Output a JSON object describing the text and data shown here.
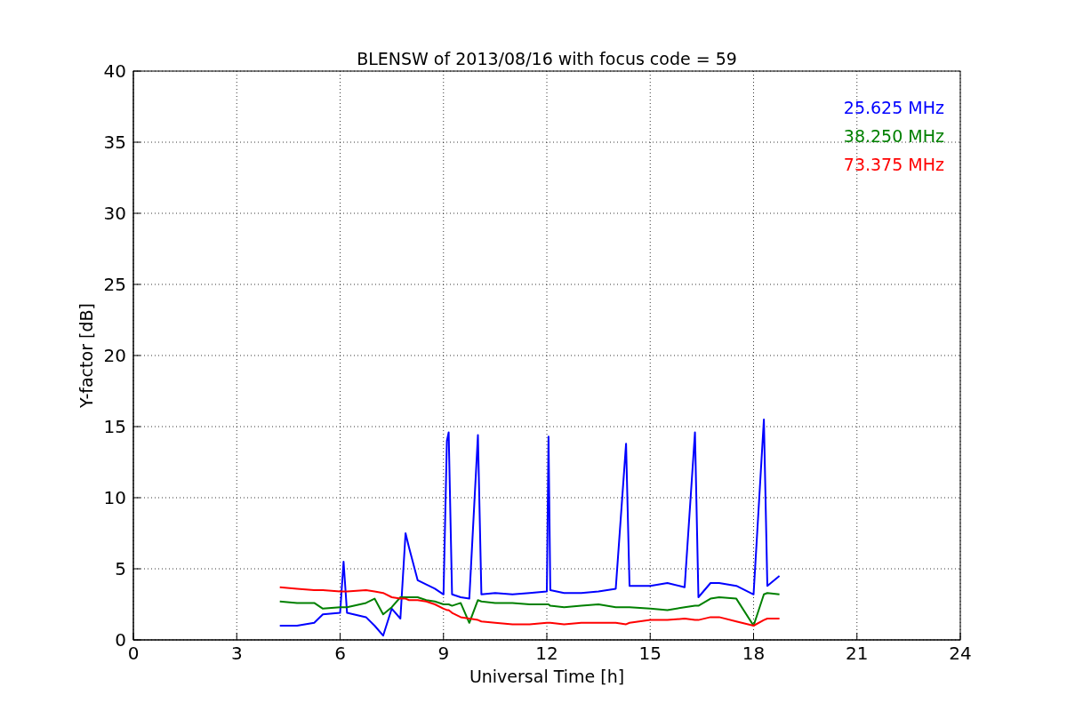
{
  "figure": {
    "chart_data": {
      "type": "line",
      "title": "BLENSW of 2013/08/16 with focus code = 59",
      "xlabel": "Universal Time [h]",
      "ylabel": "Y-factor [dB]",
      "x": [
        4.25,
        4.75,
        5.25,
        5.5,
        6.0,
        6.1,
        6.2,
        6.75,
        7.0,
        7.25,
        7.5,
        7.75,
        7.9,
        8.0,
        8.25,
        8.5,
        8.75,
        9.0,
        9.1,
        9.15,
        9.25,
        9.5,
        9.75,
        10.0,
        10.1,
        10.5,
        11.0,
        11.5,
        12.0,
        12.05,
        12.1,
        12.5,
        13.0,
        13.5,
        14.0,
        14.3,
        14.4,
        15.0,
        15.5,
        16.0,
        16.3,
        16.4,
        16.75,
        17.0,
        17.5,
        18.0,
        18.3,
        18.4,
        18.75
      ],
      "series": [
        {
          "name": "25.625 MHz",
          "color": "#0000ff",
          "values": [
            1.0,
            1.0,
            1.2,
            1.8,
            1.9,
            5.5,
            1.9,
            1.6,
            1.0,
            0.3,
            2.2,
            1.5,
            7.5,
            6.5,
            4.2,
            3.9,
            3.6,
            3.2,
            14.0,
            14.6,
            3.2,
            3.0,
            2.9,
            14.4,
            3.2,
            3.3,
            3.2,
            3.3,
            3.4,
            14.3,
            3.5,
            3.3,
            3.3,
            3.4,
            3.6,
            13.8,
            3.8,
            3.8,
            4.0,
            3.7,
            14.6,
            3.0,
            4.0,
            4.0,
            3.8,
            3.2,
            15.5,
            3.8,
            4.5
          ]
        },
        {
          "name": "38.250 MHz",
          "color": "#008000",
          "values": [
            2.7,
            2.6,
            2.6,
            2.2,
            2.3,
            2.3,
            2.3,
            2.6,
            2.9,
            1.8,
            2.3,
            3.0,
            3.0,
            3.0,
            3.0,
            2.8,
            2.7,
            2.5,
            2.5,
            2.5,
            2.4,
            2.6,
            1.2,
            2.8,
            2.7,
            2.6,
            2.6,
            2.5,
            2.5,
            2.5,
            2.4,
            2.3,
            2.4,
            2.5,
            2.3,
            2.3,
            2.3,
            2.2,
            2.1,
            2.3,
            2.4,
            2.4,
            2.9,
            3.0,
            2.9,
            1.0,
            3.2,
            3.3,
            3.2
          ]
        },
        {
          "name": "73.375 MHz",
          "color": "#ff0000",
          "values": [
            3.7,
            3.6,
            3.5,
            3.5,
            3.4,
            3.4,
            3.4,
            3.5,
            3.4,
            3.3,
            3.0,
            2.9,
            2.9,
            2.8,
            2.8,
            2.7,
            2.5,
            2.2,
            2.1,
            2.1,
            1.9,
            1.6,
            1.5,
            1.4,
            1.3,
            1.2,
            1.1,
            1.1,
            1.2,
            1.2,
            1.2,
            1.1,
            1.2,
            1.2,
            1.2,
            1.1,
            1.2,
            1.4,
            1.4,
            1.5,
            1.4,
            1.4,
            1.6,
            1.6,
            1.3,
            1.0,
            1.4,
            1.5,
            1.5
          ]
        }
      ],
      "grid": true,
      "xlim": [
        0,
        24
      ],
      "ylim": [
        0,
        40
      ],
      "xticks": [
        0,
        3,
        6,
        9,
        12,
        15,
        18,
        21,
        24
      ],
      "yticks": [
        0,
        5,
        10,
        15,
        20,
        25,
        30,
        35,
        40
      ]
    }
  }
}
